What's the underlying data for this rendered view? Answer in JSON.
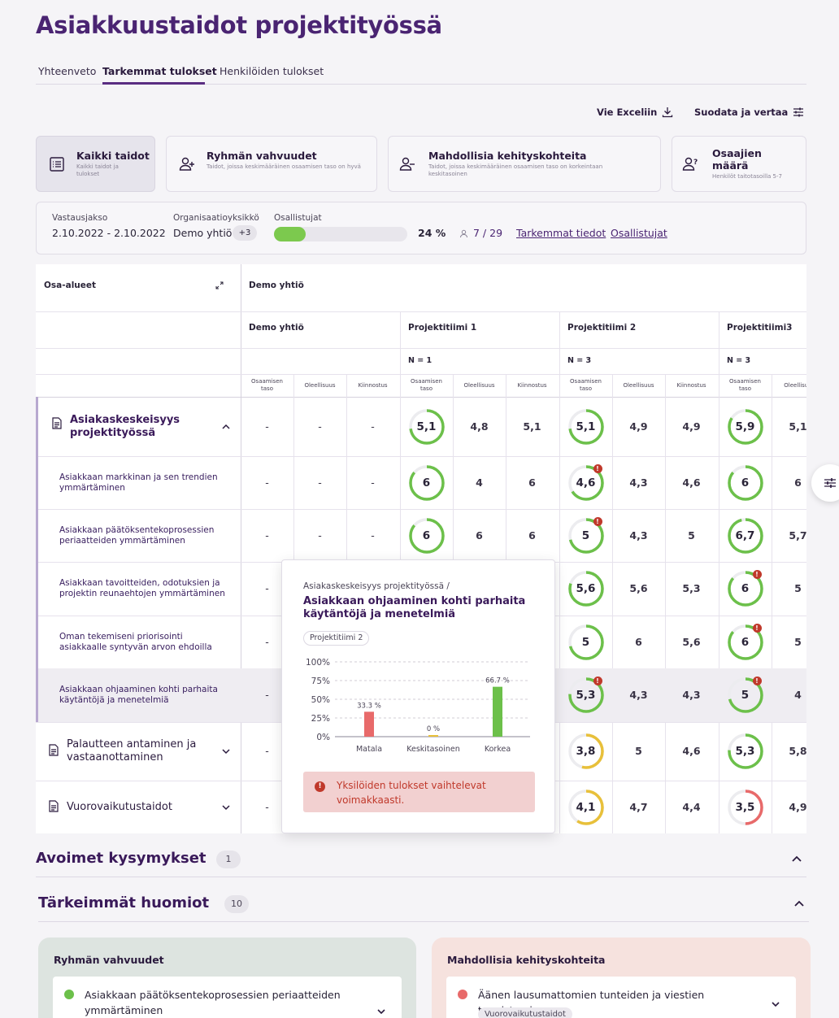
{
  "page_title": "Asiakkuustaidot projektityössä",
  "tabs": [
    {
      "label": "Yhteenveto",
      "active": false
    },
    {
      "label": "Tarkemmat tulokset",
      "active": true
    },
    {
      "label": "Henkilöiden tulokset",
      "active": false
    }
  ],
  "toolbar": {
    "export_label": "Vie Exceliin",
    "filter_label": "Suodata ja vertaa"
  },
  "filter_cards": [
    {
      "title": "Kaikki taidot",
      "subtitle": "Kaikki taidot ja tulokset",
      "icon": "list-icon",
      "selected": true
    },
    {
      "title": "Ryhmän vahvuudet",
      "subtitle": "Taidot, joissa keskimääräinen osaamisen taso on hyvä",
      "icon": "user-plus-icon",
      "selected": false
    },
    {
      "title": "Mahdollisia kehityskohteita",
      "subtitle": "Taidot, joissa keskimääräinen osaamisen taso on korkeintaan keskitasoinen",
      "icon": "user-minus-icon",
      "selected": false
    },
    {
      "title": "Osaajien määrä",
      "subtitle": "Henkilöt taitotasoilla 5-7",
      "icon": "users-question-icon",
      "selected": false
    }
  ],
  "info": {
    "period_label": "Vastausjakso",
    "period_value": "2.10.2022 - 2.10.2022",
    "org_label": "Organisaatioyksikkö",
    "org_value": "Demo yhtiö",
    "org_extra": "+3",
    "participants_label": "Osallistujat",
    "progress_fraction": 0.24,
    "percent_text": "24 %",
    "count_text": "7 / 29",
    "details_link": "Tarkemmat tiedot",
    "participants_link": "Osallistujat"
  },
  "table": {
    "first_col_header": "Osa-alueet",
    "org_header": "Demo yhtiö",
    "groups": [
      {
        "name": "Demo yhtiö",
        "n": ""
      },
      {
        "name": "Projektitiimi 1",
        "n": "N = 1"
      },
      {
        "name": "Projektitiimi 2",
        "n": "N = 3"
      },
      {
        "name": "Projektitiimi3",
        "n": "N = 3"
      }
    ],
    "subheaders": [
      "Osaamisen taso",
      "Oleellisuus",
      "Kiinnostus"
    ],
    "subheader_cut": "Oleellisuu",
    "rows": [
      {
        "label": "Asiakaskeskeisyys projektityössä",
        "type": "group",
        "expanded": true,
        "cells": [
          "-",
          "-",
          "-",
          "5,1",
          "4,8",
          "5,1",
          "5,1",
          "4,9",
          "4,9",
          "5,9",
          "5,1"
        ],
        "ring": [
          0.73,
          0.73,
          0.84
        ],
        "alerts": [
          false,
          false,
          false
        ]
      },
      {
        "label": "Asiakkaan markkinan ja sen trendien ymmärtäminen",
        "type": "skill",
        "cells": [
          "-",
          "-",
          "-",
          "6",
          "4",
          "6",
          "4,6",
          "4,3",
          "4,6",
          "6",
          "6"
        ],
        "ring": [
          0.86,
          0.66,
          0.86
        ],
        "alerts": [
          false,
          true,
          false
        ]
      },
      {
        "label": "Asiakkaan päätöksentekoprosessien periaatteiden ymmärtäminen",
        "type": "skill",
        "cells": [
          "-",
          "-",
          "-",
          "6",
          "6",
          "6",
          "5",
          "4,3",
          "5",
          "6,7",
          "5,7"
        ],
        "ring": [
          0.86,
          0.71,
          0.96
        ],
        "alerts": [
          false,
          true,
          false
        ]
      },
      {
        "label": "Asiakkaan tavoitteiden, odotuksien ja projektin reunaehtojen ymmärtäminen",
        "type": "skill",
        "cells": [
          "-",
          "",
          "",
          "",
          "",
          "",
          "5,6",
          "5,6",
          "5,3",
          "6",
          "5"
        ],
        "ring": [
          null,
          0.8,
          0.86
        ],
        "alerts": [
          false,
          false,
          true
        ]
      },
      {
        "label": "Oman tekemiseni priorisointi asiakkaalle syntyvän arvon ehdoilla",
        "type": "skill",
        "cells": [
          "-",
          "",
          "",
          "",
          "",
          "",
          "5",
          "6",
          "5,6",
          "6",
          "5"
        ],
        "ring": [
          null,
          0.71,
          0.86
        ],
        "alerts": [
          false,
          false,
          true
        ]
      },
      {
        "label": "Asiakkaan ohjaaminen kohti parhaita käytäntöjä ja menetelmiä",
        "type": "skill",
        "highlight": true,
        "cells": [
          "-",
          "",
          "",
          "",
          "",
          "",
          "5,3",
          "4,3",
          "4,3",
          "5",
          "4"
        ],
        "ring": [
          null,
          0.76,
          0.71
        ],
        "alerts": [
          false,
          true,
          true
        ]
      },
      {
        "label": "Palautteen antaminen ja vastaanottaminen",
        "type": "group",
        "expanded": false,
        "cells": [
          "-",
          "",
          "",
          "",
          "",
          "",
          "3,8",
          "5",
          "4,6",
          "5,3",
          "5,8"
        ],
        "ring": [
          null,
          0.54,
          0.76
        ],
        "alerts": [
          false,
          false,
          false
        ]
      },
      {
        "label": "Vuorovaikutustaidot",
        "type": "group",
        "expanded": false,
        "cells": [
          "-",
          "",
          "",
          "",
          "",
          "",
          "4,1",
          "4,7",
          "4,4",
          "3,5",
          "4,9"
        ],
        "ring": [
          null,
          0.59,
          0.5
        ],
        "alerts": [
          false,
          false,
          false
        ]
      }
    ]
  },
  "popover": {
    "breadcrumb": "Asiakaskeskeisyys projektityössä /",
    "title": "Asiakkaan ohjaaminen kohti parhaita käytäntöjä ja menetelmiä",
    "tag": "Projektitiimi 2",
    "warning": "Yksilöiden tulokset vaihtelevat voimakkaasti.",
    "chart_data": {
      "type": "bar",
      "categories": [
        "Matala",
        "Keskitasoinen",
        "Korkea"
      ],
      "values": [
        33.3,
        0,
        66.7
      ],
      "value_labels": [
        "33.3 %",
        "0 %",
        "66.7 %"
      ],
      "ylim": [
        0,
        100
      ],
      "yticks": [
        "100%",
        "75%",
        "50%",
        "25%",
        "0%"
      ],
      "colors": [
        "#e86a6a",
        "#e8c03a",
        "#6cc04a"
      ]
    }
  },
  "sections": {
    "open_questions": {
      "title": "Avoimet kysymykset",
      "count": "1"
    },
    "key_notes": {
      "title": "Tärkeimmät huomiot",
      "count": "10"
    }
  },
  "bottom_cards": [
    {
      "title": "Ryhmän vahvuudet",
      "item": "Asiakkaan päätöksentekoprosessien periaatteiden ymmärtäminen",
      "dot_color": "#6cc04a"
    },
    {
      "title": "Mahdollisia kehityskohteita",
      "item": "Äänen lausumattomien tunteiden ja viestien tunnistaminen",
      "tag": "Vuorovaikutustaidot",
      "dot_color": "#e86a6a"
    }
  ],
  "colors": {
    "brand": "#4a2472",
    "ring_green": "#6cc04a",
    "ring_yellow": "#e8c03a",
    "ring_red": "#e86a6a",
    "alert_red": "#c0392b"
  }
}
